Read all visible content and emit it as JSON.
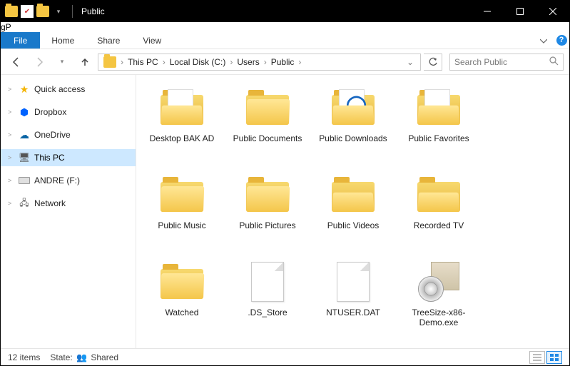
{
  "titlebar": {
    "title": "Public"
  },
  "watermark": "gP",
  "ribbon": {
    "file": "File",
    "tabs": [
      "Home",
      "Share",
      "View"
    ]
  },
  "breadcrumbs": [
    "This PC",
    "Local Disk (C:)",
    "Users",
    "Public"
  ],
  "search": {
    "placeholder": "Search Public"
  },
  "sidebar": {
    "items": [
      {
        "label": "Quick access",
        "icon": "star",
        "arrow": ">"
      },
      {
        "label": "Dropbox",
        "icon": "dropbox",
        "arrow": ">"
      },
      {
        "label": "OneDrive",
        "icon": "cloud",
        "arrow": ">"
      },
      {
        "label": "This PC",
        "icon": "monitor",
        "arrow": ">",
        "selected": true
      },
      {
        "label": "ANDRE (F:)",
        "icon": "drive",
        "arrow": ">"
      },
      {
        "label": "Network",
        "icon": "network",
        "arrow": ">"
      }
    ]
  },
  "items": [
    {
      "name": "Desktop BAK AD",
      "type": "folder-open-paper"
    },
    {
      "name": "Public Documents",
      "type": "folder"
    },
    {
      "name": "Public Downloads",
      "type": "folder-open-glyph"
    },
    {
      "name": "Public Favorites",
      "type": "folder-open-paper"
    },
    {
      "name": "Public Music",
      "type": "folder"
    },
    {
      "name": "Public Pictures",
      "type": "folder"
    },
    {
      "name": "Public Videos",
      "type": "folder-open"
    },
    {
      "name": "Recorded TV",
      "type": "folder-open"
    },
    {
      "name": "Watched",
      "type": "folder"
    },
    {
      "name": ".DS_Store",
      "type": "file"
    },
    {
      "name": "NTUSER.DAT",
      "type": "file"
    },
    {
      "name": "TreeSize-x86-Demo.exe",
      "type": "installer"
    }
  ],
  "status": {
    "count": "12 items",
    "state_label": "State:",
    "state_value": "Shared"
  }
}
